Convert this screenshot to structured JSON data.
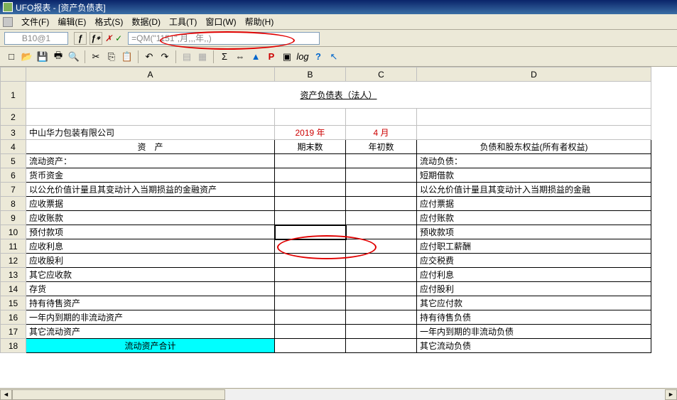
{
  "titlebar": {
    "text": "UFO报表 - [资产负债表]"
  },
  "menu": {
    "file": "文件(F)",
    "edit": "编辑(E)",
    "format": "格式(S)",
    "data": "数据(D)",
    "tool": "工具(T)",
    "window": "窗口(W)",
    "help": "帮助(H)"
  },
  "formula": {
    "cellref": "B10@1",
    "value": "=QM(\"1151\",月,,,年,,)"
  },
  "toolbar": {
    "new": "□",
    "open": "📂",
    "save": "💾",
    "print": "🖶",
    "preview": "🔍",
    "cut": "✂",
    "copy": "⎘",
    "paste": "📋",
    "undo": "↶",
    "redo": "↷",
    "sigma": "Σ",
    "width": "⇔",
    "delta": "",
    "p": "P",
    "star": "▣",
    "log": "log",
    "help": "?",
    "cursor": "↖"
  },
  "cols": {
    "A": "A",
    "B": "B",
    "C": "C",
    "D": "D"
  },
  "rows": [
    "1",
    "2",
    "3",
    "4",
    "5",
    "6",
    "7",
    "8",
    "9",
    "10",
    "11",
    "12",
    "13",
    "14",
    "15",
    "16",
    "17",
    "18"
  ],
  "sheet": {
    "title": "资产负债表（法人）",
    "company": "中山华力包装有限公司",
    "year": "2019 年",
    "month": "4 月",
    "h_asset": "资　产",
    "h_end": "期末数",
    "h_begin": "年初数",
    "h_liab": "负债和股东权益(所有者权益)",
    "r5a": "流动资产：",
    "r5d": "流动负债：",
    "r6a": "货币资金",
    "r6d": "短期借款",
    "r7a": "以公允价值计量且其变动计入当期损益的金融资产",
    "r7d": "以公允价值计量且其变动计入当期损益的金融",
    "r8a": "应收票据",
    "r8d": "应付票据",
    "r9a": "应收账款",
    "r9d": "应付账款",
    "r10a": "预付款项",
    "r10d": "预收款项",
    "r11a": "应收利息",
    "r11d": "应付职工薪酬",
    "r12a": "应收股利",
    "r12d": "应交税费",
    "r13a": "其它应收款",
    "r13d": "应付利息",
    "r14a": "存货",
    "r14d": "应付股利",
    "r15a": "持有待售资产",
    "r15d": "其它应付款",
    "r16a": "一年内到期的非流动资产",
    "r16d": "持有待售负债",
    "r17a": "其它流动资产",
    "r17d": "一年内到期的非流动负债",
    "r18a": "流动资产合计",
    "r18d": "其它流动负债"
  }
}
